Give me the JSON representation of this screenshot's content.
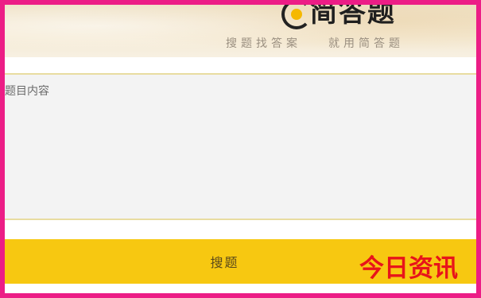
{
  "header": {
    "logo_text": "简答题",
    "tagline_left": "搜题找答案",
    "tagline_right": "就用简答题"
  },
  "question": {
    "placeholder": "题目内容",
    "value": ""
  },
  "search_button": {
    "label": "搜题"
  },
  "watermark": {
    "text": "今日资讯"
  },
  "colors": {
    "frame": "#ec1d86",
    "button": "#f7c811",
    "logo_accent": "#f5b800",
    "watermark": "#e8141a"
  }
}
